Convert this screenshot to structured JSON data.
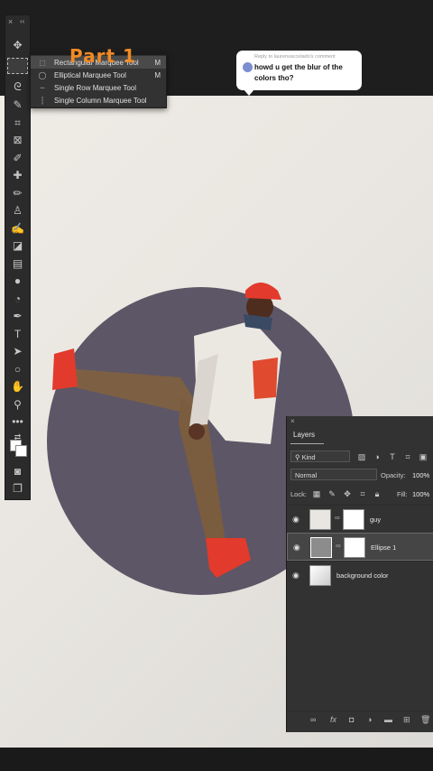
{
  "overlay": {
    "part_label": "Part 1"
  },
  "comment": {
    "reply_to": "Reply to laurenvaccelado's comment",
    "text": "howd u get the blur of the colors tho?"
  },
  "toolbar": {
    "close": "×",
    "collapse": "‹‹",
    "tools": [
      "move-tool",
      "rectangular-marquee-tool",
      "lasso-tool",
      "quick-selection-tool",
      "crop-tool",
      "frame-tool",
      "eyedropper-tool",
      "healing-brush-tool",
      "brush-tool",
      "clone-stamp-tool",
      "history-brush-tool",
      "eraser-tool",
      "gradient-tool",
      "blur-tool",
      "dodge-tool",
      "pen-tool",
      "type-tool",
      "path-selection-tool",
      "ellipse-tool",
      "hand-tool",
      "zoom-tool",
      "more-tools",
      "swap-colors",
      "foreground-background",
      "quick-mask",
      "screen-mode"
    ]
  },
  "marquee_menu": {
    "items": [
      {
        "label": "Rectangular Marquee Tool",
        "shortcut": "M"
      },
      {
        "label": "Elliptical Marquee Tool",
        "shortcut": "M"
      },
      {
        "label": "Single Row Marquee Tool",
        "shortcut": ""
      },
      {
        "label": "Single Column Marquee Tool",
        "shortcut": ""
      }
    ]
  },
  "layers_panel": {
    "close": "×",
    "tab": "Layers",
    "filter": "Kind",
    "blend_mode": "Normal",
    "opacity_label": "Opacity:",
    "opacity": "100%",
    "lock_label": "Lock:",
    "fill_label": "Fill:",
    "fill": "100%",
    "layers": [
      {
        "name": "guy",
        "visible": true
      },
      {
        "name": "Ellipse 1",
        "visible": true,
        "selected": true
      },
      {
        "name": "background color",
        "visible": true
      }
    ]
  },
  "colors": {
    "circle": "#5d5666",
    "accent_orange": "#f08a24",
    "shoe_red": "#e23a2c"
  }
}
